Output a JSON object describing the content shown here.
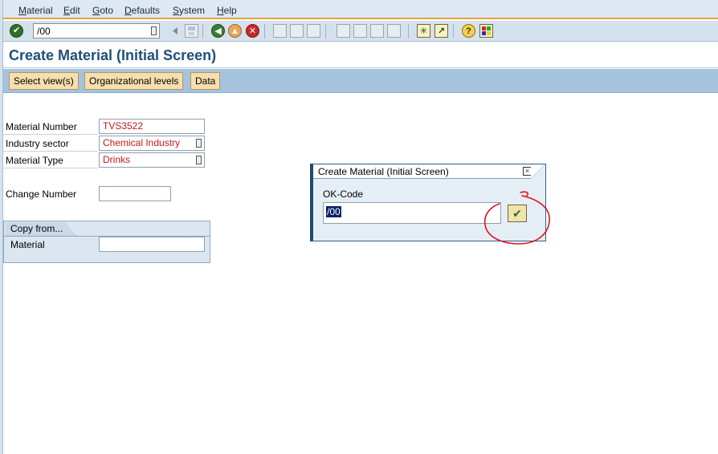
{
  "menu": {
    "items": [
      {
        "u": "M",
        "rest": "aterial"
      },
      {
        "u": "E",
        "rest": "dit"
      },
      {
        "u": "G",
        "rest": "oto"
      },
      {
        "u": "D",
        "rest": "efaults"
      },
      {
        "u": "S",
        "rest": "ystem"
      },
      {
        "u": "H",
        "rest": "elp"
      }
    ]
  },
  "toolbar": {
    "command_field_value": "/00",
    "icons": [
      "enter-icon",
      "back-arrow-icon",
      "save-icon",
      "back-icon",
      "exit-icon",
      "cancel-icon",
      "print-icon",
      "find-icon",
      "find-next-icon",
      "first-page-icon",
      "previous-page-icon",
      "next-page-icon",
      "last-page-icon",
      "create-session-icon",
      "create-shortcut-icon",
      "help-icon",
      "customize-layout-icon"
    ]
  },
  "title": "Create Material (Initial Screen)",
  "app_toolbar": {
    "select_views": "Select view(s)",
    "org_levels": "Organizational levels",
    "data": "Data"
  },
  "form": {
    "material_number": {
      "label": "Material Number",
      "value": "TVS3522"
    },
    "industry_sector": {
      "label": "Industry sector",
      "value": "Chemical Industry"
    },
    "material_type": {
      "label": "Material Type",
      "value": "Drinks"
    },
    "change_number": {
      "label": "Change Number",
      "value": ""
    }
  },
  "copy_from": {
    "title": "Copy from...",
    "material_label": "Material",
    "material_value": ""
  },
  "popup": {
    "title": "Create Material (Initial Screen)",
    "close_glyph": "×",
    "ok_code_label": "OK-Code",
    "ok_code_value": "/00"
  },
  "colors": {
    "accent_orange": "#e8a23a",
    "title_blue": "#1f4f7a",
    "app_toolbar_blue": "#a5c3de",
    "field_value_red": "#c31919",
    "annotation_red": "#e0141e"
  }
}
